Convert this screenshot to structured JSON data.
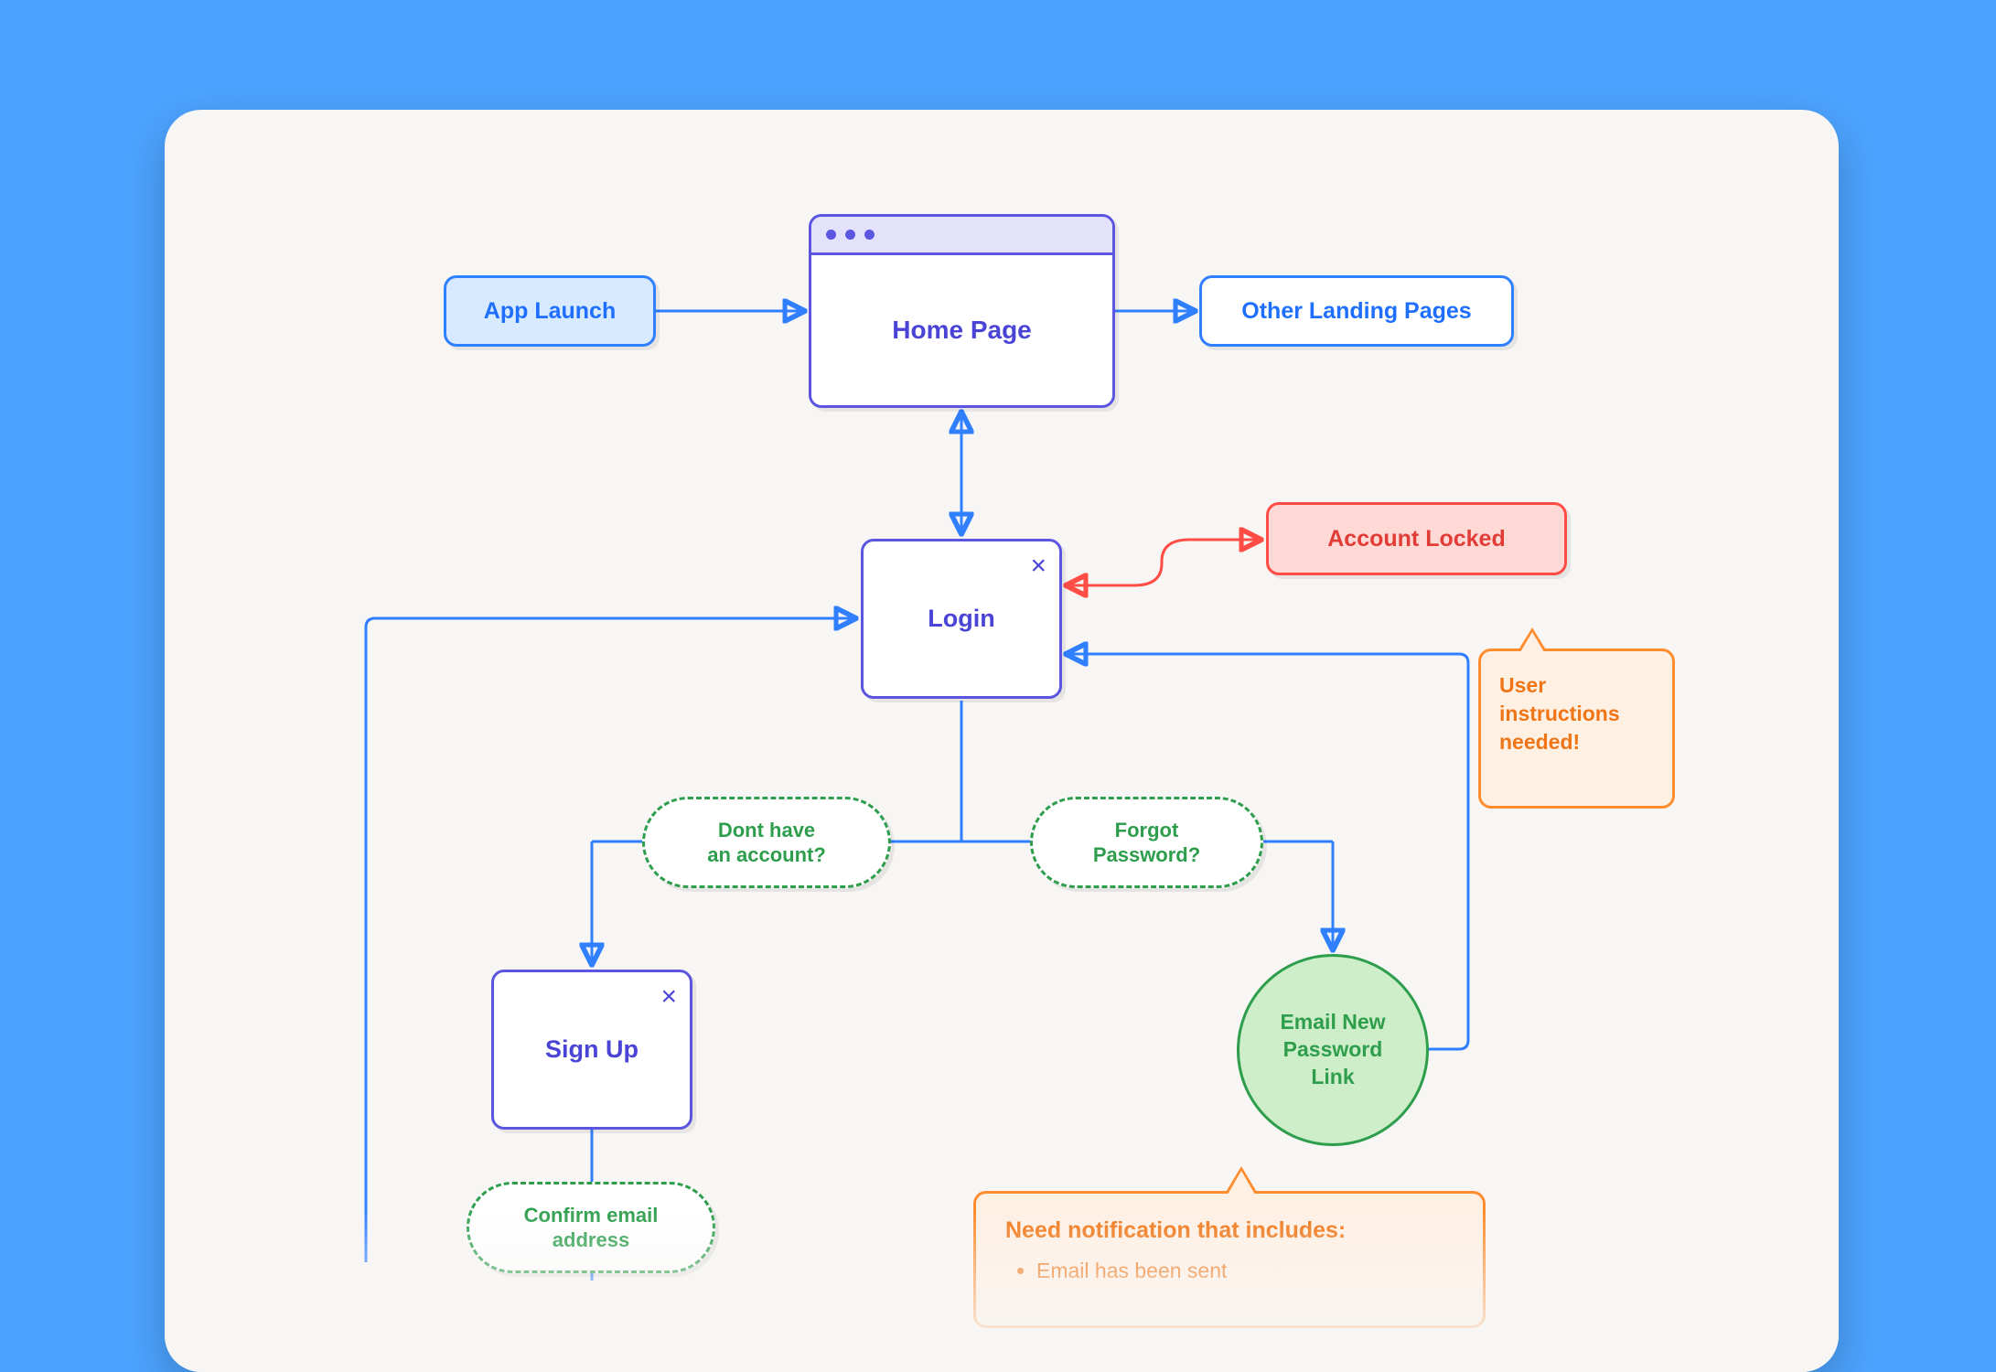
{
  "nodes": {
    "app_launch": "App Launch",
    "home_page": "Home Page",
    "other_landing": "Other Landing Pages",
    "login": "Login",
    "account_locked": "Account Locked",
    "user_instructions": "User\ninstructions\nneeded!",
    "dont_have_account": "Dont have\nan account?",
    "forgot_password": "Forgot\nPassword?",
    "email_link": "Email New\nPassword\nLink",
    "sign_up": "Sign Up",
    "confirm_email": "Confirm email\naddress"
  },
  "bottom_note": {
    "title": "Need notification that includes:",
    "items": [
      "Email has been sent"
    ]
  },
  "colors": {
    "blue": "#2f7fff",
    "purple": "#5b55e0",
    "red": "#ff4d46",
    "orange": "#ff8c2e",
    "green": "#2e9e4d"
  },
  "chart_data": {
    "type": "flowchart",
    "nodes": [
      {
        "id": "app_launch",
        "label": "App Launch",
        "shape": "rect",
        "style": "blue-filled"
      },
      {
        "id": "home_page",
        "label": "Home Page",
        "shape": "browser-window",
        "style": "purple"
      },
      {
        "id": "other_landing",
        "label": "Other Landing Pages",
        "shape": "rect",
        "style": "blue-outline"
      },
      {
        "id": "login",
        "label": "Login",
        "shape": "modal",
        "style": "purple"
      },
      {
        "id": "account_locked",
        "label": "Account Locked",
        "shape": "rect",
        "style": "red-filled"
      },
      {
        "id": "user_instructions_note",
        "label": "User instructions needed!",
        "shape": "callout",
        "style": "orange",
        "attached_to": "account_locked"
      },
      {
        "id": "dont_have_account",
        "label": "Dont have an account?",
        "shape": "pill-dashed",
        "style": "green"
      },
      {
        "id": "forgot_password",
        "label": "Forgot Password?",
        "shape": "pill-dashed",
        "style": "green"
      },
      {
        "id": "sign_up",
        "label": "Sign Up",
        "shape": "modal",
        "style": "purple"
      },
      {
        "id": "email_link",
        "label": "Email New Password Link",
        "shape": "circle",
        "style": "green-filled"
      },
      {
        "id": "confirm_email",
        "label": "Confirm email address",
        "shape": "pill-dashed",
        "style": "green"
      },
      {
        "id": "notification_note",
        "label": "Need notification that includes:",
        "items": [
          "Email has been sent"
        ],
        "shape": "callout",
        "style": "orange",
        "attached_to": "email_link"
      }
    ],
    "edges": [
      {
        "from": "app_launch",
        "to": "home_page",
        "color": "blue",
        "arrow": "to"
      },
      {
        "from": "home_page",
        "to": "other_landing",
        "color": "blue",
        "arrow": "to"
      },
      {
        "from": "home_page",
        "to": "login",
        "color": "blue",
        "arrow": "both"
      },
      {
        "from": "login",
        "to": "account_locked",
        "color": "red",
        "arrow": "both"
      },
      {
        "from": "login",
        "to": "dont_have_account",
        "color": "blue",
        "arrow": "none",
        "through": true
      },
      {
        "from": "login",
        "to": "forgot_password",
        "color": "blue",
        "arrow": "none",
        "through": true
      },
      {
        "from": "dont_have_account",
        "to": "sign_up",
        "color": "blue",
        "arrow": "to"
      },
      {
        "from": "forgot_password",
        "to": "email_link",
        "color": "blue",
        "arrow": "to"
      },
      {
        "from": "email_link",
        "to": "login",
        "color": "blue",
        "arrow": "to"
      },
      {
        "from": "sign_up",
        "to": "login",
        "color": "blue",
        "arrow": "to",
        "note": "loops left back to login"
      },
      {
        "from": "sign_up",
        "to": "confirm_email",
        "color": "blue",
        "arrow": "none",
        "through": true
      }
    ]
  }
}
